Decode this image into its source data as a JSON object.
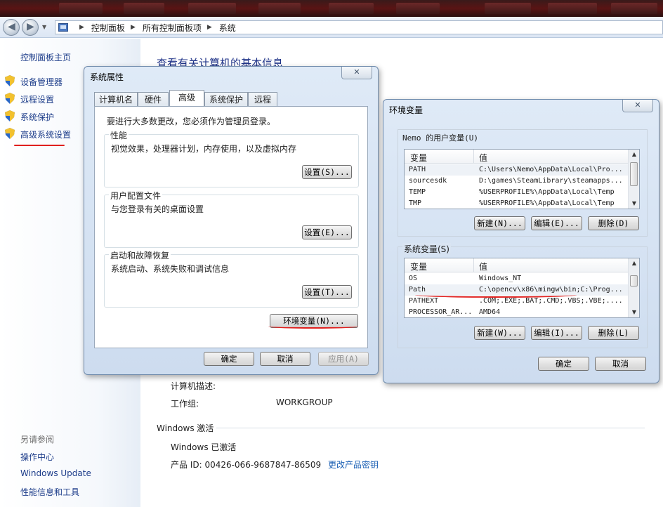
{
  "breadcrumbs": [
    "控制面板",
    "所有控制面板项",
    "系统"
  ],
  "leftnav": {
    "home": "控制面板主页",
    "items": [
      "设备管理器",
      "远程设置",
      "系统保护",
      "高级系统设置"
    ],
    "see_also": "另请参阅",
    "links": [
      "操作中心",
      "Windows Update",
      "性能信息和工具"
    ]
  },
  "main": {
    "heading": "查看有关计算机的基本信息",
    "desc_label": "计算机描述:",
    "workgroup_label": "工作组:",
    "workgroup_value": "WORKGROUP",
    "activation_title": "Windows 激活",
    "activated_text": "Windows 已激活",
    "product_id": "产品 ID: 00426-066-9687847-86509",
    "change_key_link": "更改产品密钥"
  },
  "sysprop": {
    "title": "系统属性",
    "tabs": [
      "计算机名",
      "硬件",
      "高级",
      "系统保护",
      "远程"
    ],
    "admin_note": "要进行大多数更改，您必须作为管理员登录。",
    "perf_title": "性能",
    "perf_desc": "视觉效果，处理器计划，内存使用，以及虚拟内存",
    "perf_btn": "设置(S)...",
    "profile_title": "用户配置文件",
    "profile_desc": "与您登录有关的桌面设置",
    "profile_btn": "设置(E)...",
    "startup_title": "启动和故障恢复",
    "startup_desc": "系统启动、系统失败和调试信息",
    "startup_btn": "设置(T)...",
    "env_btn": "环境变量(N)...",
    "ok": "确定",
    "cancel": "取消",
    "apply": "应用(A)"
  },
  "envvars": {
    "title": "环境变量",
    "user_group": "Nemo 的用户变量(U)",
    "col_var": "变量",
    "col_val": "值",
    "user_rows": [
      {
        "name": "PATH",
        "value": "C:\\Users\\Nemo\\AppData\\Local\\Pro..."
      },
      {
        "name": "sourcesdk",
        "value": "D:\\games\\SteamLibrary\\steamapps..."
      },
      {
        "name": "TEMP",
        "value": "%USERPROFILE%\\AppData\\Local\\Temp"
      },
      {
        "name": "TMP",
        "value": "%USERPROFILE%\\AppData\\Local\\Temp"
      }
    ],
    "user_new": "新建(N)...",
    "user_edit": "编辑(E)...",
    "user_delete": "删除(D)",
    "sys_group": "系统变量(S)",
    "sys_rows": [
      {
        "name": "OS",
        "value": "Windows_NT"
      },
      {
        "name": "Path",
        "value": "C:\\opencv\\x86\\mingw\\bin;C:\\Prog..."
      },
      {
        "name": "PATHEXT",
        "value": ".COM;.EXE;.BAT;.CMD;.VBS;.VBE;...."
      },
      {
        "name": "PROCESSOR_AR...",
        "value": "AMD64"
      }
    ],
    "sys_new": "新建(W)...",
    "sys_edit": "编辑(I)...",
    "sys_delete": "删除(L)",
    "ok": "确定",
    "cancel": "取消"
  }
}
